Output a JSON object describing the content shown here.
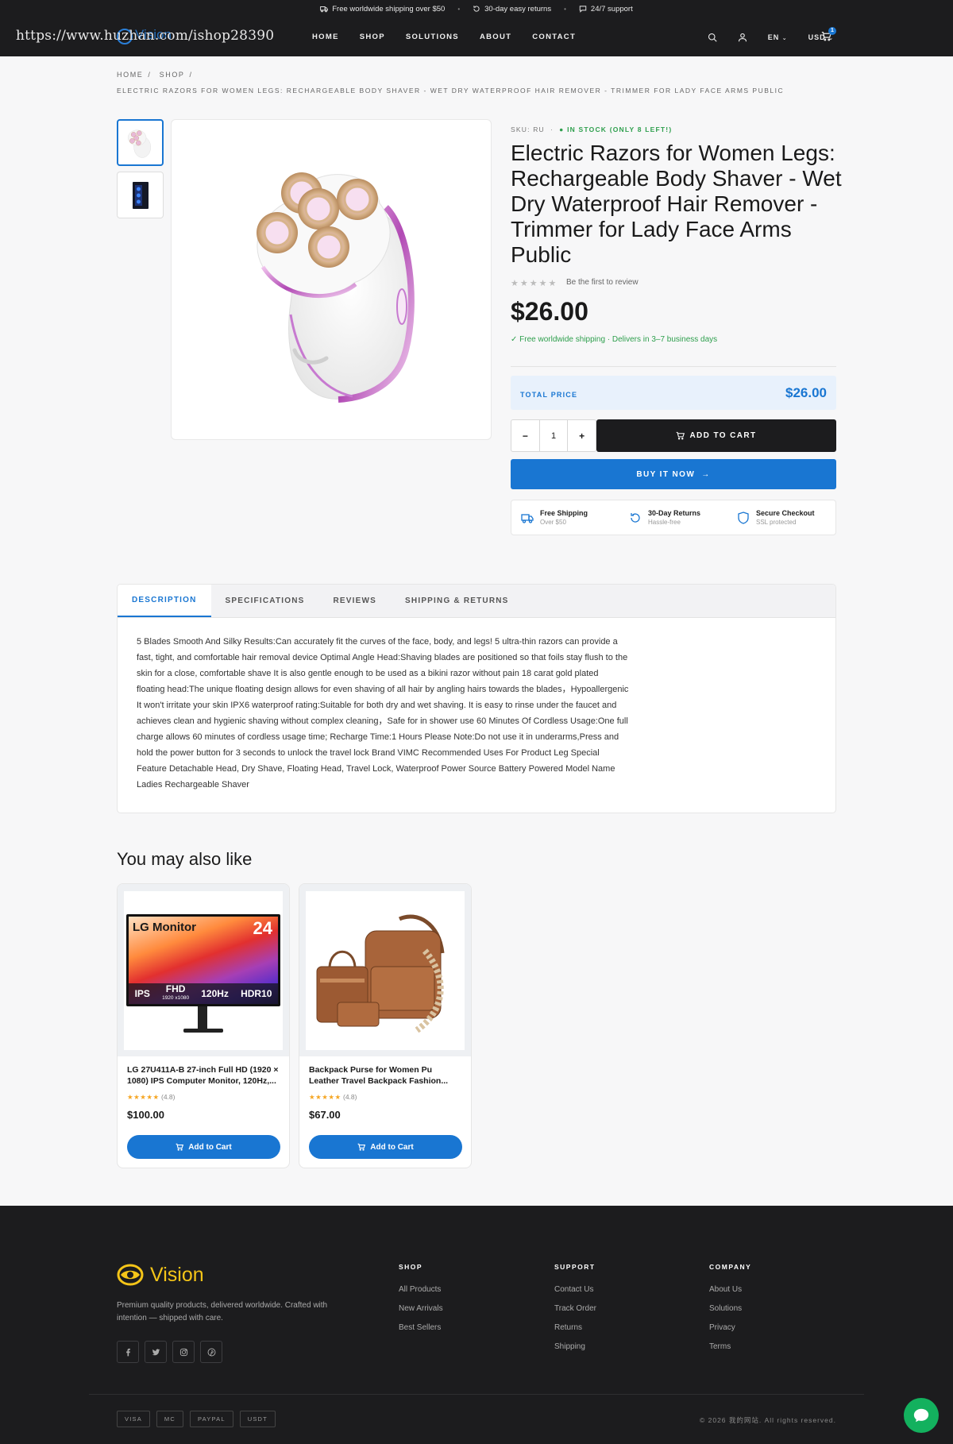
{
  "topbar": {
    "shipping": "Free worldwide shipping over $50",
    "returns": "30-day easy returns",
    "support": "24/7 support"
  },
  "nav": {
    "url_watermark": "https://www.huzhan.com/ishop28390",
    "brand": "Vision",
    "menu": [
      "HOME",
      "SHOP",
      "SOLUTIONS",
      "ABOUT",
      "CONTACT"
    ],
    "language": "EN",
    "currency": "USD",
    "cart_count": "1"
  },
  "breadcrumb": {
    "items": [
      "HOME",
      "SHOP"
    ],
    "separator": "/",
    "current": "ELECTRIC RAZORS FOR WOMEN LEGS: RECHARGEABLE BODY SHAVER - WET DRY WATERPROOF HAIR REMOVER - TRIMMER FOR LADY FACE ARMS PUBLIC"
  },
  "product": {
    "sku": "SKU: RU",
    "stock": "IN STOCK (ONLY 8 LEFT!)",
    "title": "Electric Razors for Women Legs: Rechargeable Body Shaver - Wet Dry Waterproof Hair Remover - Trimmer for Lady Face Arms Public",
    "rating_stars": 0,
    "review_text": "Be the first to review",
    "price": "$26.00",
    "shipping_note": "Free worldwide shipping · Delivers in 3–7 business days",
    "total_label": "TOTAL PRICE",
    "total_value": "$26.00",
    "quantity": "1",
    "qty_minus": "−",
    "qty_plus": "+",
    "add_to_cart": "ADD TO CART",
    "buy_now": "BUY IT NOW"
  },
  "perks": [
    {
      "title": "Free Shipping",
      "sub": "Over $50",
      "icon": "truck-icon"
    },
    {
      "title": "30-Day Returns",
      "sub": "Hassle-free",
      "icon": "refresh-icon"
    },
    {
      "title": "Secure Checkout",
      "sub": "SSL protected",
      "icon": "shield-icon"
    }
  ],
  "tabs": [
    "DESCRIPTION",
    "SPECIFICATIONS",
    "REVIEWS",
    "SHIPPING & RETURNS"
  ],
  "description": "5 Blades Smooth And Silky Results:Can accurately fit the curves of the face, body, and legs! 5 ultra-thin razors can provide a fast, tight, and comfortable hair removal device Optimal Angle Head:Shaving blades are positioned so that foils stay flush to the skin for a close, comfortable shave It is also gentle enough to be used as a bikini razor without pain 18 carat gold plated floating head:The unique floating design allows for even shaving of all hair by angling hairs towards the blades，Hypoallergenic It won't irritate your skin IPX6 waterproof rating:Suitable for both dry and wet shaving. It is easy to rinse under the faucet and achieves clean and hygienic shaving without complex cleaning，Safe for in shower use 60 Minutes Of Cordless Usage:One full charge allows 60 minutes of cordless usage time; Recharge Time:1 Hours Please Note:Do not use it in underarms,Press and hold the power button for 3 seconds to unlock the travel lock Brand VIMC Recommended Uses For Product Leg Special Feature Detachable Head, Dry Shave, Floating Head, Travel Lock, Waterproof Power Source Battery Powered Model Name Ladies Rechargeable Shaver",
  "related": {
    "heading": "You may also like",
    "items": [
      {
        "name": "LG 27U411A-B 27-inch Full HD (1920 × 1080) IPS Computer Monitor, 120Hz,...",
        "stars": "★★★★★",
        "rating": "(4.8)",
        "price": "$100.00",
        "button": "Add to Cart",
        "monitor": {
          "brand": "LG Monitor",
          "size": "24",
          "features": [
            "IPS",
            "FHD",
            "120Hz",
            "HDR10"
          ],
          "res": "1920 x1080"
        }
      },
      {
        "name": "Backpack Purse for Women Pu Leather Travel Backpack Fashion...",
        "stars": "★★★★★",
        "rating": "(4.8)",
        "price": "$67.00",
        "button": "Add to Cart"
      }
    ]
  },
  "footer": {
    "brand": "Vision",
    "tagline": "Premium quality products, delivered worldwide. Crafted with intention — shipped with care.",
    "columns": [
      {
        "title": "SHOP",
        "links": [
          "All Products",
          "New Arrivals",
          "Best Sellers"
        ]
      },
      {
        "title": "SUPPORT",
        "links": [
          "Contact Us",
          "Track Order",
          "Returns",
          "Shipping"
        ]
      },
      {
        "title": "COMPANY",
        "links": [
          "About Us",
          "Solutions",
          "Privacy",
          "Terms"
        ]
      }
    ],
    "payments": [
      "VISA",
      "MC",
      "PAYPAL",
      "USDT"
    ],
    "copyright": "© 2026 我的网站. All rights reserved."
  },
  "colors": {
    "accent": "#1976d2",
    "dark": "#1c1c1e",
    "success": "#2e9f4d",
    "brand_yellow": "#f5c518",
    "chat_green": "#13b15e"
  }
}
